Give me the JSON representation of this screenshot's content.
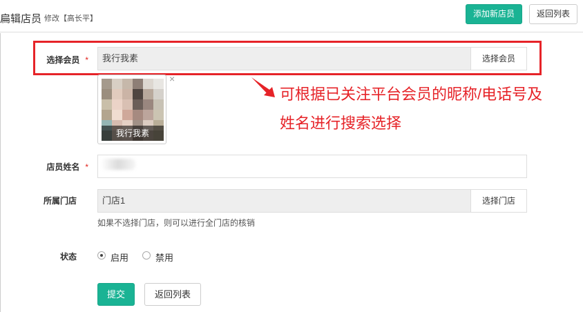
{
  "header": {
    "title": "扁辑店员",
    "subtitle": "修改【高长平】",
    "add_button": "添加新店员",
    "back_button": "返回列表"
  },
  "member": {
    "label": "选择会员",
    "required": "*",
    "value": "我行我素",
    "button": "选择会员",
    "thumb_caption": "我行我素",
    "thumb_close": "×"
  },
  "annotation": {
    "line1": "可根据已关注平台会员的昵称/电话号及",
    "line2": "姓名进行搜索选择"
  },
  "name_field": {
    "label": "店员姓名",
    "required": "*"
  },
  "store": {
    "label": "所属门店",
    "value": "门店1",
    "button": "选择门店",
    "hint": "如果不选择门店，则可以进行全门店的核销"
  },
  "status": {
    "label": "状态",
    "options": [
      {
        "label": "启用",
        "checked": true
      },
      {
        "label": "禁用",
        "checked": false
      }
    ]
  },
  "footer": {
    "submit": "提交",
    "back": "返回列表"
  }
}
